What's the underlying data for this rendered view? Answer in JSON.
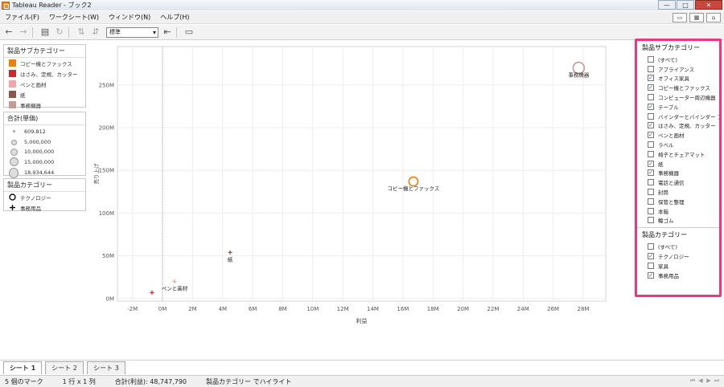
{
  "window": {
    "title": "Tableau Reader - ブック2",
    "btn_min": "—",
    "btn_max": "□",
    "btn_close": "✕"
  },
  "menu": {
    "items": [
      "ファイル(F)",
      "ワークシート(W)",
      "ウィンドウ(N)",
      "ヘルプ(H)"
    ]
  },
  "toolbar": {
    "zoom_select": "標準"
  },
  "legend_color": {
    "title": "製品サブカテゴリー",
    "items": [
      {
        "label": "コピー機とファックス",
        "color": "#f07d0f"
      },
      {
        "label": "はさみ、定規、カッター",
        "color": "#d62728"
      },
      {
        "label": "ペンと画材",
        "color": "#f4a6a6"
      },
      {
        "label": "紙",
        "color": "#8c564b"
      },
      {
        "label": "事務機器",
        "color": "#c49c94"
      }
    ]
  },
  "legend_size": {
    "title": "合計(単価)",
    "items": [
      "609,812",
      "5,000,000",
      "10,000,000",
      "15,000,000",
      "18,934,644"
    ]
  },
  "legend_shape": {
    "title": "製品カテゴリー",
    "items": [
      {
        "label": "テクノロジー",
        "shape": "circle-icon"
      },
      {
        "label": "事務用品",
        "shape": "plus-icon"
      }
    ]
  },
  "chart_data": {
    "type": "scatter",
    "xlabel": "利益",
    "ylabel": "売り上げ",
    "xlim": [
      -3,
      29.5
    ],
    "ylim": [
      -3,
      295
    ],
    "x_ticks": [
      "-2M",
      "0M",
      "2M",
      "4M",
      "6M",
      "8M",
      "10M",
      "12M",
      "14M",
      "16M",
      "18M",
      "20M",
      "22M",
      "24M",
      "26M",
      "28M"
    ],
    "x_tick_values": [
      -2,
      0,
      2,
      4,
      6,
      8,
      10,
      12,
      14,
      16,
      18,
      20,
      22,
      24,
      26,
      28
    ],
    "y_ticks": [
      "0M",
      "50M",
      "100M",
      "150M",
      "200M",
      "250M"
    ],
    "y_tick_values": [
      0,
      50,
      100,
      150,
      200,
      250
    ],
    "points": [
      {
        "label": "事務機器",
        "x": 27.7,
        "y": 270,
        "color": "#c49c94",
        "shape": "circle",
        "size_value": 18934644
      },
      {
        "label": "コピー機とファックス",
        "x": 16.7,
        "y": 137,
        "color": "#f07d0f",
        "shape": "circle",
        "size_value": 10000000
      },
      {
        "label": "紙",
        "x": 4.5,
        "y": 54,
        "color": "#8c564b",
        "shape": "plus",
        "size_value": 609812
      },
      {
        "label": "ペンと画材",
        "x": 0.8,
        "y": 20,
        "color": "#f4a6a6",
        "shape": "plus",
        "size_value": 609812
      },
      {
        "label": "",
        "x": -0.7,
        "y": 7,
        "color": "#d62728",
        "shape": "plus",
        "size_value": 609812
      }
    ]
  },
  "filters": {
    "subcategory": {
      "title": "製品サブカテゴリー",
      "items": [
        {
          "label": "(すべて)",
          "checked": false
        },
        {
          "label": "アプライアンス",
          "checked": false
        },
        {
          "label": "オフィス家具",
          "checked": true
        },
        {
          "label": "コピー機とファックス",
          "checked": true
        },
        {
          "label": "コンピューター周辺機器",
          "checked": false
        },
        {
          "label": "テーブル",
          "checked": true
        },
        {
          "label": "バインダーとバインダー ア...",
          "checked": false
        },
        {
          "label": "はさみ、定規、カッター",
          "checked": true
        },
        {
          "label": "ペンと画材",
          "checked": true
        },
        {
          "label": "ラベル",
          "checked": false
        },
        {
          "label": "椅子とチェアマット",
          "checked": false
        },
        {
          "label": "紙",
          "checked": true
        },
        {
          "label": "事務機器",
          "checked": true
        },
        {
          "label": "電話と通信",
          "checked": false
        },
        {
          "label": "封筒",
          "checked": false
        },
        {
          "label": "保管と整理",
          "checked": false
        },
        {
          "label": "本箱",
          "checked": false
        },
        {
          "label": "輪ゴム",
          "checked": false
        }
      ]
    },
    "category": {
      "title": "製品カテゴリー",
      "items": [
        {
          "label": "(すべて)",
          "checked": false
        },
        {
          "label": "テクノロジー",
          "checked": true
        },
        {
          "label": "家具",
          "checked": false
        },
        {
          "label": "事務用品",
          "checked": true
        }
      ]
    }
  },
  "sheet_tabs": [
    "シート 1",
    "シート 2",
    "シート 3"
  ],
  "status": {
    "marks": "5 個のマーク",
    "rows_cols": "1 行 x 1 列",
    "sum": "合計(利益): 48,747,790",
    "highlight": "製品カテゴリー でハイライト"
  }
}
